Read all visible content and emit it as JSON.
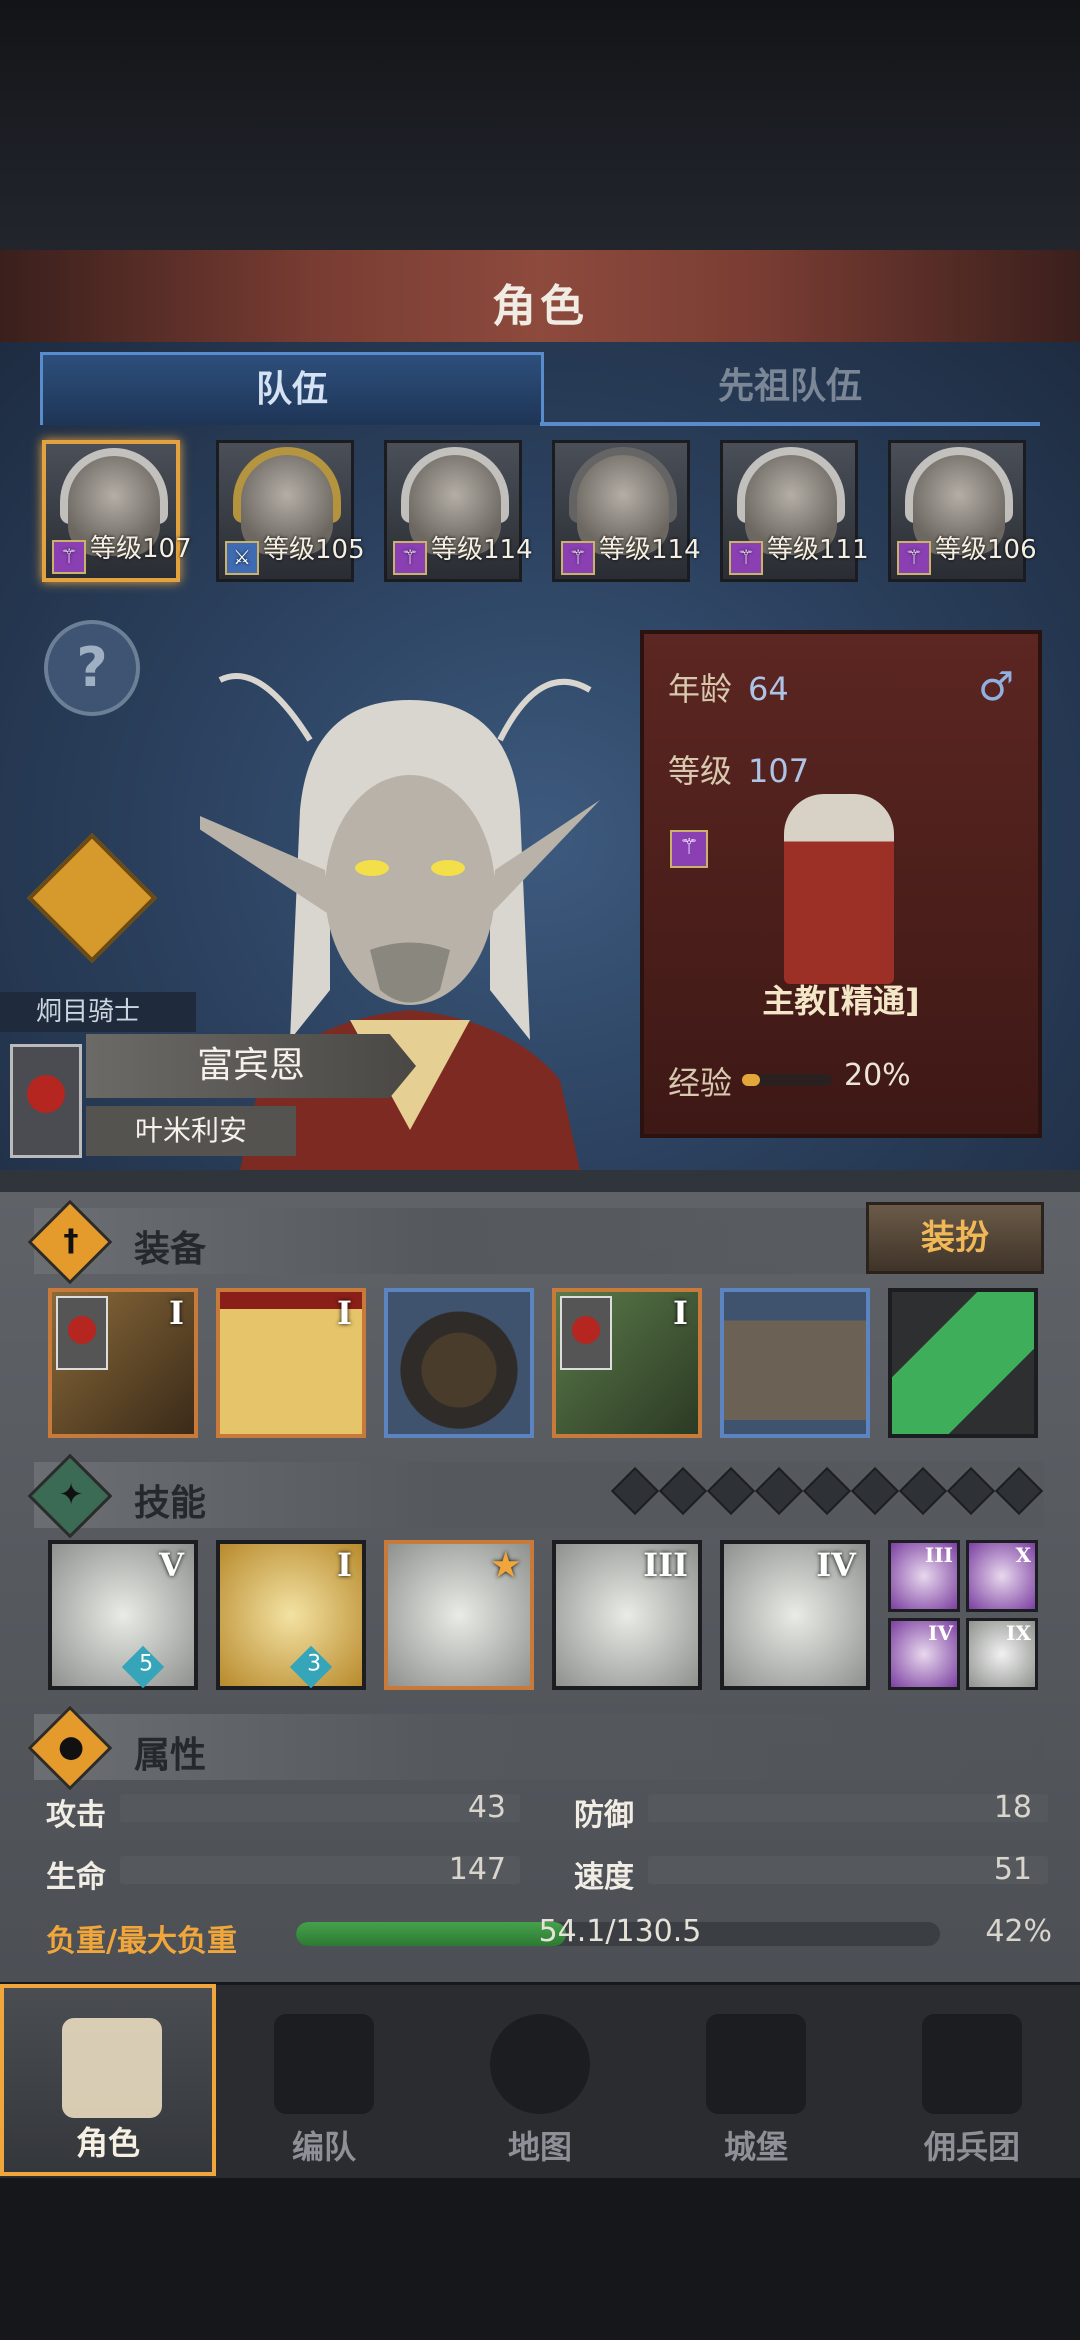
{
  "header": {
    "title": "角色"
  },
  "tabs": [
    {
      "label": "队伍",
      "active": true
    },
    {
      "label": "先祖队伍",
      "active": false
    }
  ],
  "roster": [
    {
      "level_label": "等级107",
      "selected": true
    },
    {
      "level_label": "等级105",
      "selected": false
    },
    {
      "level_label": "等级114",
      "selected": false
    },
    {
      "level_label": "等级114",
      "selected": false
    },
    {
      "level_label": "等级111",
      "selected": false
    },
    {
      "level_label": "等级106",
      "selected": false
    }
  ],
  "help_icon": "?",
  "character": {
    "class_label": "炯目骑士",
    "name": "富宾恩",
    "subname": "叶米利安",
    "age_label": "年龄",
    "age": "64",
    "gender_icon": "♂",
    "level_label": "等级",
    "level": "107",
    "class_name": "主教[精通]",
    "exp_label": "经验",
    "exp_percent": "20%",
    "exp_fraction": 0.2
  },
  "equipment": {
    "title": "装备",
    "dress_button": "装扮",
    "slots": [
      {
        "tier": "I",
        "rarity": "orange",
        "icon": "golden-head-trinket"
      },
      {
        "tier": "I",
        "rarity": "orange",
        "icon": "holy-tome"
      },
      {
        "tier": "",
        "rarity": "blue",
        "icon": "hooded-cloak"
      },
      {
        "tier": "I",
        "rarity": "orange",
        "icon": "green-armor"
      },
      {
        "tier": "",
        "rarity": "blue",
        "icon": "wrapped-boots"
      },
      {
        "tier": "",
        "rarity": "none",
        "icon": "green-crystal"
      }
    ]
  },
  "skills": {
    "title": "技能",
    "pip_count": 9,
    "slots": [
      {
        "tier": "V",
        "badge": "5",
        "icon": "spear-figure"
      },
      {
        "tier": "I",
        "badge": "3",
        "icon": "heal-shield"
      },
      {
        "tier": "",
        "badge": "",
        "icon": "crystal-figure",
        "starred": true
      },
      {
        "tier": "III",
        "badge": "",
        "icon": "radiant-crystal"
      },
      {
        "tier": "IV",
        "badge": "",
        "icon": "crystal-hand"
      }
    ],
    "mini": [
      {
        "tier": "III",
        "icon": "purple-burst"
      },
      {
        "tier": "X",
        "icon": "purple-star"
      },
      {
        "tier": "IV",
        "icon": "purple-spear"
      },
      {
        "tier": "IX",
        "icon": "grey-explosion"
      }
    ]
  },
  "attributes": {
    "title": "属性",
    "stats": [
      {
        "label": "攻击",
        "value": "43"
      },
      {
        "label": "防御",
        "value": "18"
      },
      {
        "label": "生命",
        "value": "147"
      },
      {
        "label": "速度",
        "value": "51"
      }
    ],
    "load_label": "负重/最大负重",
    "load_value": "54.1/130.5",
    "load_percent": "42%",
    "load_fraction": 0.42
  },
  "nav": [
    {
      "label": "角色",
      "active": true
    },
    {
      "label": "编队",
      "active": false
    },
    {
      "label": "地图",
      "active": false
    },
    {
      "label": "城堡",
      "active": false
    },
    {
      "label": "佣兵团",
      "active": false
    }
  ],
  "colors": {
    "accent": "#f0a63a",
    "tab_blue": "#5a8ccb",
    "title_red": "#8d4a3d",
    "load_green": "#46a14b"
  }
}
